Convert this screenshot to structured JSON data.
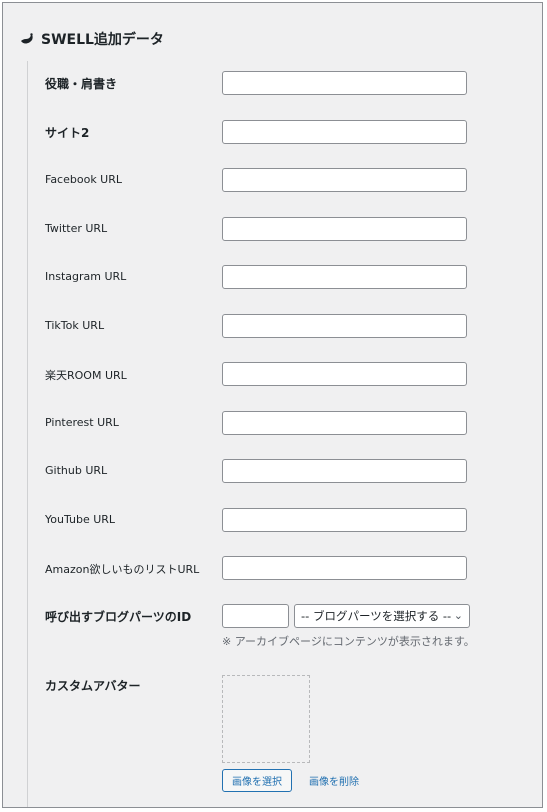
{
  "section": {
    "title": "SWELL追加データ",
    "icon": "swell-bird-icon"
  },
  "fields": [
    {
      "label": "役職・肩書き",
      "value": ""
    },
    {
      "label": "サイト2",
      "value": ""
    },
    {
      "label": "Facebook URL",
      "value": ""
    },
    {
      "label": "Twitter URL",
      "value": ""
    },
    {
      "label": "Instagram URL",
      "value": ""
    },
    {
      "label": "TikTok URL",
      "value": ""
    },
    {
      "label": "楽天ROOM URL",
      "value": ""
    },
    {
      "label": "Pinterest URL",
      "value": ""
    },
    {
      "label": "Github URL",
      "value": ""
    },
    {
      "label": "YouTube URL",
      "value": ""
    },
    {
      "label": "Amazon欲しいものリストURL",
      "value": ""
    }
  ],
  "blog_parts": {
    "label": "呼び出すブログパーツのID",
    "id_value": "",
    "select_value": "-- ブログパーツを選択する --",
    "note": "※ アーカイブページにコンテンツが表示されます。"
  },
  "avatar": {
    "label": "カスタムアバター",
    "select_button": "画像を選択",
    "delete_button": "画像を削除"
  },
  "colors": {
    "accent": "#2271b1",
    "background": "#f0f0f1",
    "border": "#8c8f94"
  }
}
